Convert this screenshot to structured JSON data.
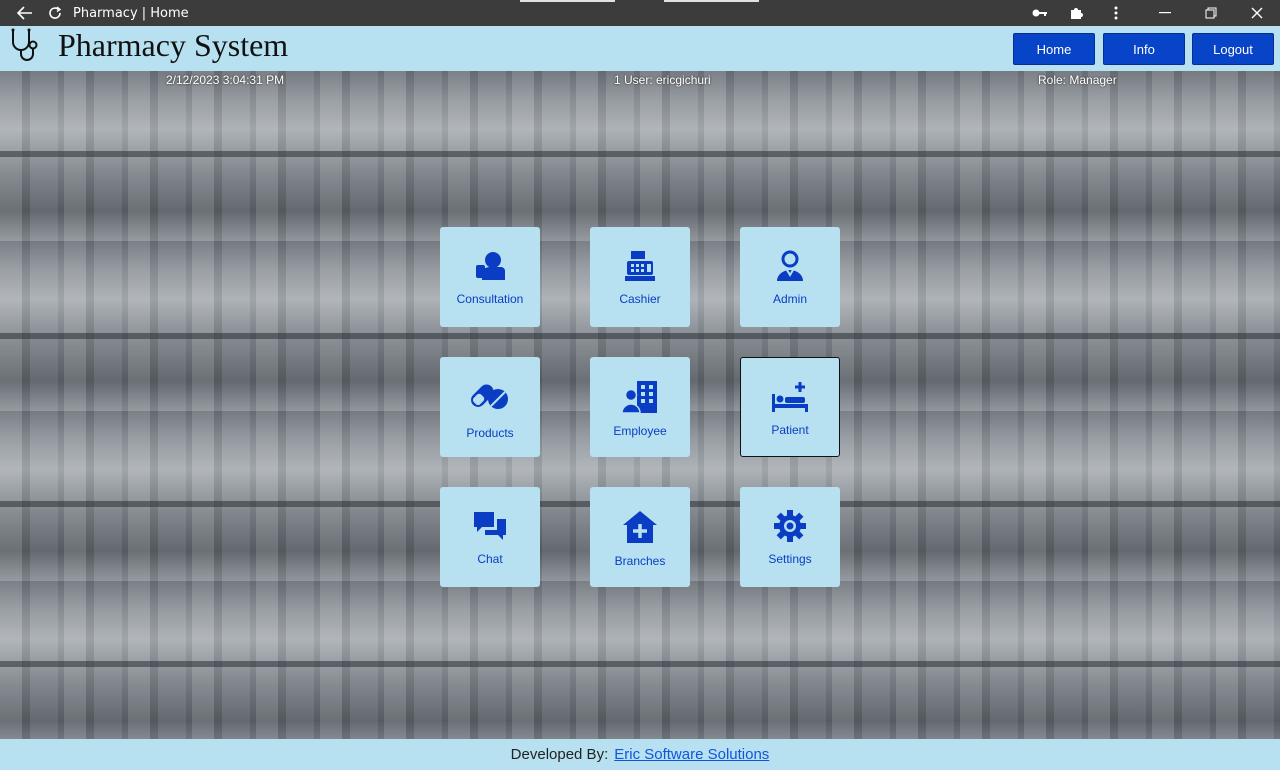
{
  "window": {
    "title": "Pharmacy | Home"
  },
  "header": {
    "app_title": "Pharmacy System",
    "nav": {
      "home": "Home",
      "info": "Info",
      "logout": "Logout"
    }
  },
  "status": {
    "datetime": "2/12/2023 3:04:31 PM",
    "user": "1 User: ericgichuri",
    "role": "Role: Manager"
  },
  "tiles": [
    {
      "label": "Consultation",
      "icon": "consultation-icon"
    },
    {
      "label": "Cashier",
      "icon": "cash-register-icon"
    },
    {
      "label": "Admin",
      "icon": "admin-user-icon"
    },
    {
      "label": "Products",
      "icon": "pills-icon"
    },
    {
      "label": "Employee",
      "icon": "employee-building-icon"
    },
    {
      "label": "Patient",
      "icon": "patient-bed-icon"
    },
    {
      "label": "Chat",
      "icon": "chat-icon"
    },
    {
      "label": "Branches",
      "icon": "branch-house-icon"
    },
    {
      "label": "Settings",
      "icon": "gear-icon"
    }
  ],
  "footer": {
    "prefix": "Developed By:",
    "link": "Eric Software Solutions"
  },
  "colors": {
    "header_bg": "#b7e1f0",
    "nav_button": "#0844c8",
    "tile_icon": "#0a3dc4"
  }
}
